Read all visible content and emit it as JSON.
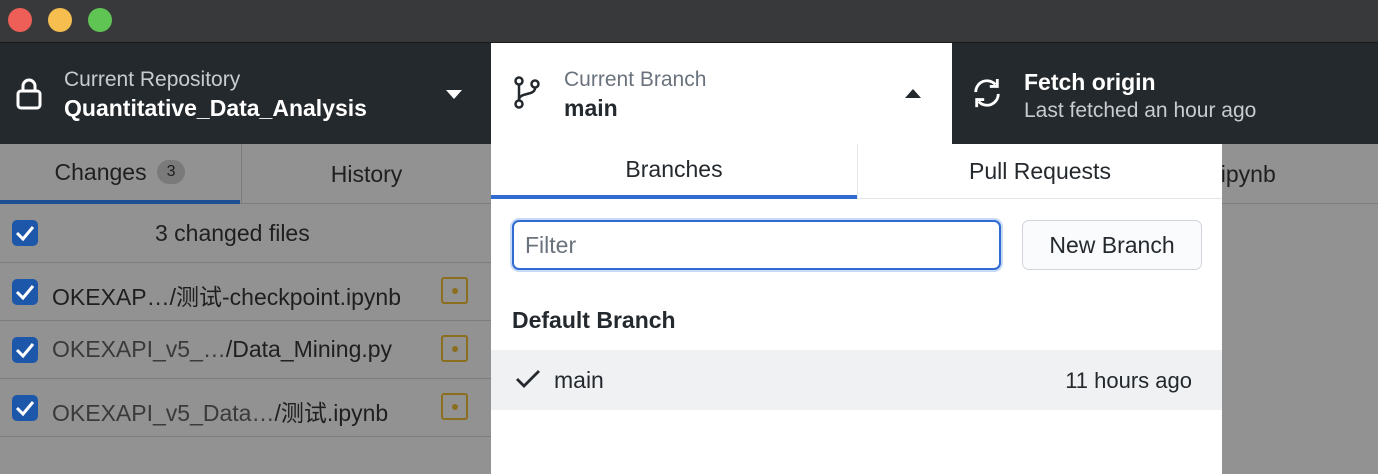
{
  "toolbar": {
    "repository": {
      "sub_label": "Current Repository",
      "name": "Quantitative_Data_Analysis"
    },
    "branch": {
      "sub_label": "Current Branch",
      "name": "main"
    },
    "fetch": {
      "label": "Fetch origin",
      "sub_label": "Last fetched an hour ago"
    }
  },
  "sidebar": {
    "tabs": [
      {
        "label": "Changes",
        "count": "3"
      },
      {
        "label": "History"
      }
    ],
    "summary": "3 changed files",
    "files": [
      {
        "prefix": "OKEXAP…",
        "name": "/测试-checkpoint.ipynb"
      },
      {
        "prefix": "OKEXAPI_v5_…",
        "name": "/Data_Mining.py"
      },
      {
        "prefix": "OKEXAPI_v5_Data…",
        "name": "/测试.ipynb"
      }
    ]
  },
  "diff_header": "t.ipynb",
  "dropdown": {
    "tabs": [
      "Branches",
      "Pull Requests"
    ],
    "filter_placeholder": "Filter",
    "new_branch_label": "New Branch",
    "section_title": "Default Branch",
    "branches": [
      {
        "name": "main",
        "time": "11 hours ago",
        "checked": true
      }
    ]
  },
  "colors": {
    "accent": "#2f6bd1",
    "toolbar_bg": "#24292e",
    "modified_status": "#8b6f1e"
  }
}
